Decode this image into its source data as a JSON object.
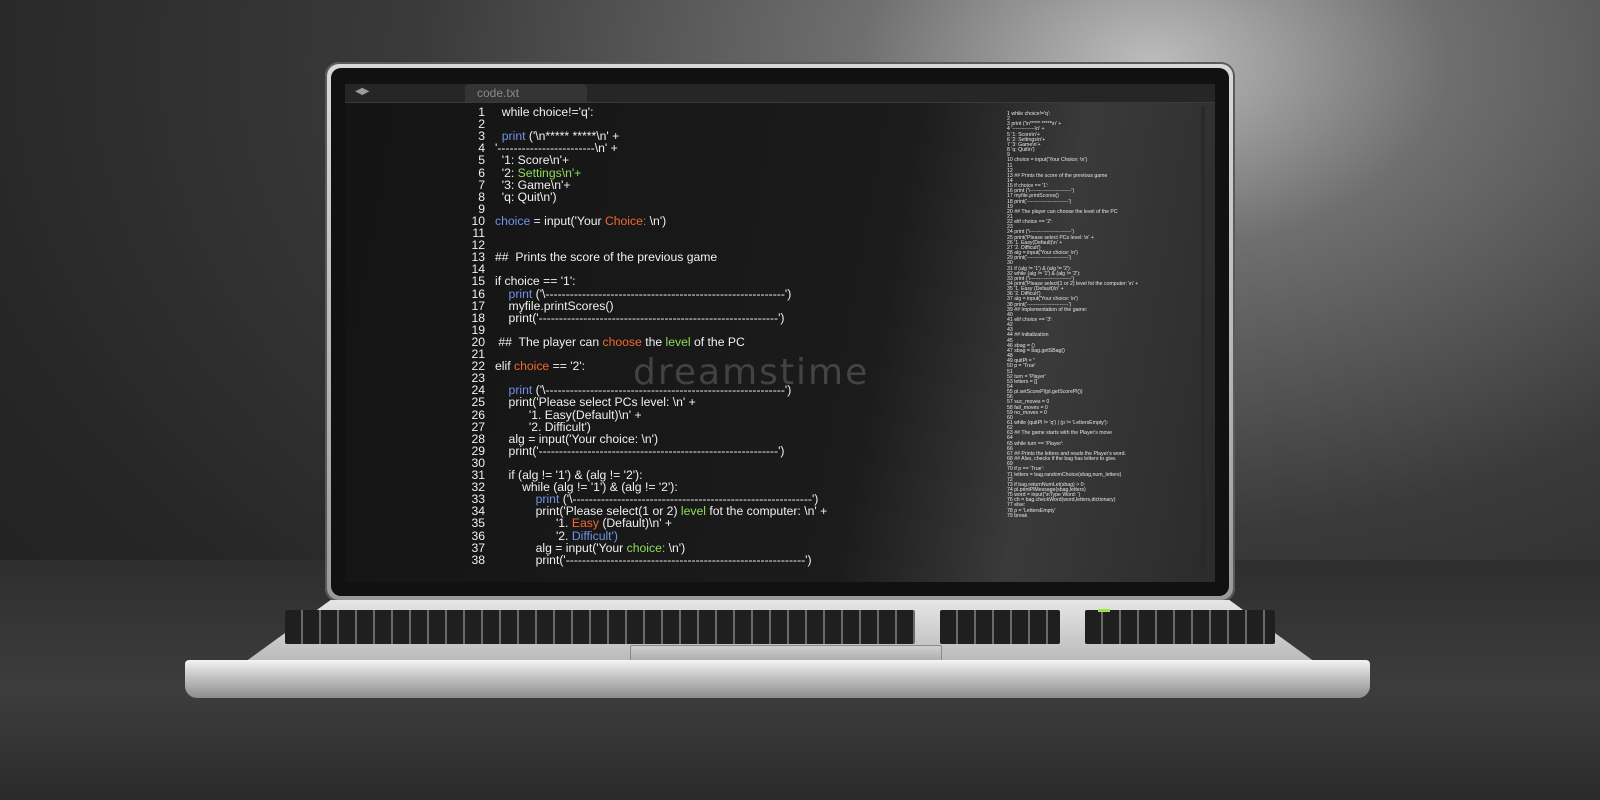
{
  "editor": {
    "tab_label": "code.txt",
    "nav_glyph": "◀▶",
    "watermark": "dreamstime"
  },
  "code_main": [
    {
      "n": "1",
      "t": [
        [
          "",
          "  while choice!='q':"
        ]
      ]
    },
    {
      "n": "2",
      "t": [
        [
          "",
          ""
        ]
      ]
    },
    {
      "n": "3",
      "t": [
        [
          "",
          "  "
        ],
        [
          "kw",
          "print"
        ],
        [
          "",
          " ('\\n***** *****\\n' +"
        ]
      ]
    },
    {
      "n": "4",
      "t": [
        [
          "",
          "'------------------------\\n' +"
        ]
      ]
    },
    {
      "n": "5",
      "t": [
        [
          "",
          "  '1: Score\\n'+"
        ]
      ]
    },
    {
      "n": "6",
      "t": [
        [
          "",
          "  '2: "
        ],
        [
          "gr",
          "Settings\\n'+"
        ]
      ]
    },
    {
      "n": "7",
      "t": [
        [
          "",
          "  '3: Game\\n'+"
        ]
      ]
    },
    {
      "n": "8",
      "t": [
        [
          "",
          "  'q: Quit\\n')"
        ]
      ]
    },
    {
      "n": "9",
      "t": [
        [
          "",
          ""
        ]
      ]
    },
    {
      "n": "10",
      "t": [
        [
          "kw",
          "choice"
        ],
        [
          "",
          " = input('Your "
        ],
        [
          "or",
          "Choice:"
        ],
        [
          "",
          " \\n')"
        ]
      ]
    },
    {
      "n": "11",
      "t": [
        [
          "",
          ""
        ]
      ]
    },
    {
      "n": "12",
      "t": [
        [
          "",
          ""
        ]
      ]
    },
    {
      "n": "13",
      "t": [
        [
          "",
          "##  Prints the score of the previous game"
        ]
      ]
    },
    {
      "n": "14",
      "t": [
        [
          "",
          ""
        ]
      ]
    },
    {
      "n": "15",
      "t": [
        [
          "",
          "if choice == '1':"
        ]
      ]
    },
    {
      "n": "16",
      "t": [
        [
          "",
          "    "
        ],
        [
          "kw",
          "print"
        ],
        [
          "",
          " ('\\-----------------------------------------------------------')"
        ]
      ]
    },
    {
      "n": "17",
      "t": [
        [
          "",
          "    myfile.printScores()"
        ]
      ]
    },
    {
      "n": "18",
      "t": [
        [
          "",
          "    print('-----------------------------------------------------------')"
        ]
      ]
    },
    {
      "n": "19",
      "t": [
        [
          "",
          ""
        ]
      ]
    },
    {
      "n": "20",
      "t": [
        [
          "",
          " ##  The player can "
        ],
        [
          "or",
          "choose"
        ],
        [
          "",
          " the "
        ],
        [
          "gr",
          "level"
        ],
        [
          "",
          " of the PC"
        ]
      ]
    },
    {
      "n": "21",
      "t": [
        [
          "",
          ""
        ]
      ]
    },
    {
      "n": "22",
      "t": [
        [
          "",
          "elif "
        ],
        [
          "or",
          "choice"
        ],
        [
          "",
          " == '2':"
        ]
      ]
    },
    {
      "n": "23",
      "t": [
        [
          "",
          ""
        ]
      ]
    },
    {
      "n": "24",
      "t": [
        [
          "",
          "    "
        ],
        [
          "kw",
          "print"
        ],
        [
          "",
          " ('\\-----------------------------------------------------------')"
        ]
      ]
    },
    {
      "n": "25",
      "t": [
        [
          "",
          "    print('Please select PCs level: \\n' +"
        ]
      ]
    },
    {
      "n": "26",
      "t": [
        [
          "",
          "          '1. Easy(Default)\\n' +"
        ]
      ]
    },
    {
      "n": "27",
      "t": [
        [
          "",
          "          '2. Difficult')"
        ]
      ]
    },
    {
      "n": "28",
      "t": [
        [
          "",
          "    alg = input('Your choice: \\n')"
        ]
      ]
    },
    {
      "n": "29",
      "t": [
        [
          "",
          "    print('-----------------------------------------------------------')"
        ]
      ]
    },
    {
      "n": "30",
      "t": [
        [
          "",
          ""
        ]
      ]
    },
    {
      "n": "31",
      "t": [
        [
          "",
          "    if (alg != '1') & (alg != '2'):"
        ]
      ]
    },
    {
      "n": "32",
      "t": [
        [
          "",
          "        while (alg != '1') & (alg != '2'):"
        ]
      ]
    },
    {
      "n": "33",
      "t": [
        [
          "",
          "            "
        ],
        [
          "kw",
          "print"
        ],
        [
          "",
          " ('\\-----------------------------------------------------------')"
        ]
      ]
    },
    {
      "n": "34",
      "t": [
        [
          "",
          "            print('Please select(1 or 2) "
        ],
        [
          "gr",
          "level"
        ],
        [
          "",
          " fot the computer: \\n' +"
        ]
      ]
    },
    {
      "n": "35",
      "t": [
        [
          "",
          "                  '1. "
        ],
        [
          "or",
          "Easy"
        ],
        [
          "",
          " (Default)\\n' +"
        ]
      ]
    },
    {
      "n": "36",
      "t": [
        [
          "",
          "                  '2. "
        ],
        [
          "kw",
          "Difficult')"
        ]
      ]
    },
    {
      "n": "37",
      "t": [
        [
          "",
          "            alg = input('Your "
        ],
        [
          "gr",
          "choice:"
        ],
        [
          "",
          " \\n')"
        ]
      ]
    },
    {
      "n": "38",
      "t": [
        [
          "",
          "            print('-----------------------------------------------------------')"
        ]
      ]
    }
  ],
  "code_mini": [
    "1 while choice!='q':",
    "2",
    "3 print ('\\n***** *****\\n' +",
    "4 '-------------\\n' +",
    "5 '1: Score\\n'+",
    "6 '2: Settings\\n'+",
    "7 '3: Game\\n'+",
    "8 'q: Quit\\n')",
    "9",
    "10 choice = input('Your Choice: \\n')",
    "11",
    "12",
    "13 ## Prints the score of the previous game",
    "14",
    "15 if choice == '1':",
    "16 print ('\\------------------------')",
    "17 myfile.printScores()",
    "18 print('------------------------')",
    "19",
    "20 ## The player can choose the level of the PC",
    "21",
    "22 elif choice == '2':",
    "23",
    "24 print ('\\------------------------')",
    "25 print('Please select PCs level: \\n' +",
    "26 '1. Easy(Default)\\n' +",
    "27 '2. Difficult')",
    "28 alg = input('Your choice: \\n')",
    "29 print('------------------------')",
    "30",
    "31 if (alg != '1') & (alg != '2'):",
    "32 while (alg != '1') & (alg != '2'):",
    "33 print ('\\------------------------')",
    "34 print('Please select(1 or 2) level fot the computer: \\n' +",
    "35 '1. Easy (Default)\\n' +",
    "36 '2. Difficult')",
    "37 alg = input('Your choice: \\n')",
    "38 print('------------------------')",
    "39 ## Implementation of the game:",
    "40",
    "41 elif choice == '3':",
    "42",
    "43",
    "44 ## Initialization",
    "45",
    "46 sbag = ()",
    "47 sbag = bag.getSBag()",
    "48",
    "49 quitPl = ''",
    "50 p = 'True'",
    "51",
    "52 turn = 'Player'",
    "53 letters = []",
    "54",
    "55 pl.setScorePl(pl.getScorePl())",
    "56",
    "57 suc_moves = 0",
    "58 fail_moves = 0",
    "59 no_moves = 0",
    "60",
    "61 while (quitPl != 'q') | (p != 'LettersEmpty'):",
    "62",
    "63 ## The game starts with the Player's move",
    "64",
    "65 while turn == 'Player':",
    "66",
    "67 ## Prints the letters and reads the Player's word.",
    "68 ## Also, checks if the bag has letters to give.",
    "69",
    "70 if p == 'True':",
    "71 letters = bag.randomChoice(sbag,num_letters)",
    "72",
    "73 if bag.returnNumLet(sbag) > 0:",
    "74 pl.printPlMessage(sbag,letters)",
    "75 word = input('\\nType Word: ')",
    "76 ch = bag.checkWord(word,letters,dictionary)",
    "77 else:",
    "78 p = 'LettersEmpty'",
    "79 break"
  ]
}
